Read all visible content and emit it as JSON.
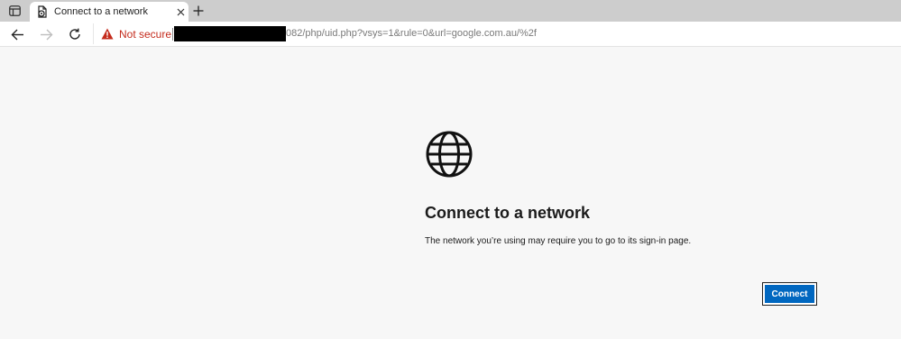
{
  "tabs": [
    {
      "title": "Connect to a network",
      "favicon": "page-settings-icon",
      "active": true
    }
  ],
  "tabstrip": {
    "tab_actions_icon": "tab-actions-icon",
    "close_icon": "close-icon",
    "new_tab_icon": "plus-icon"
  },
  "toolbar": {
    "back_icon": "arrow-left-icon",
    "forward_icon": "arrow-right-icon",
    "reload_icon": "reload-icon"
  },
  "address": {
    "security_icon": "warning-triangle-icon",
    "security_label": "Not secure",
    "url_visible": "082/php/uid.php?vsys=1&rule=0&url=google.com.au/%2f",
    "security_color": "#c42b1c"
  },
  "page": {
    "icon": "globe-icon",
    "heading": "Connect to a network",
    "message": "The network you’re using may require you to go to its sign-in page.",
    "connect_label": "Connect",
    "accent_color": "#0067c0"
  }
}
